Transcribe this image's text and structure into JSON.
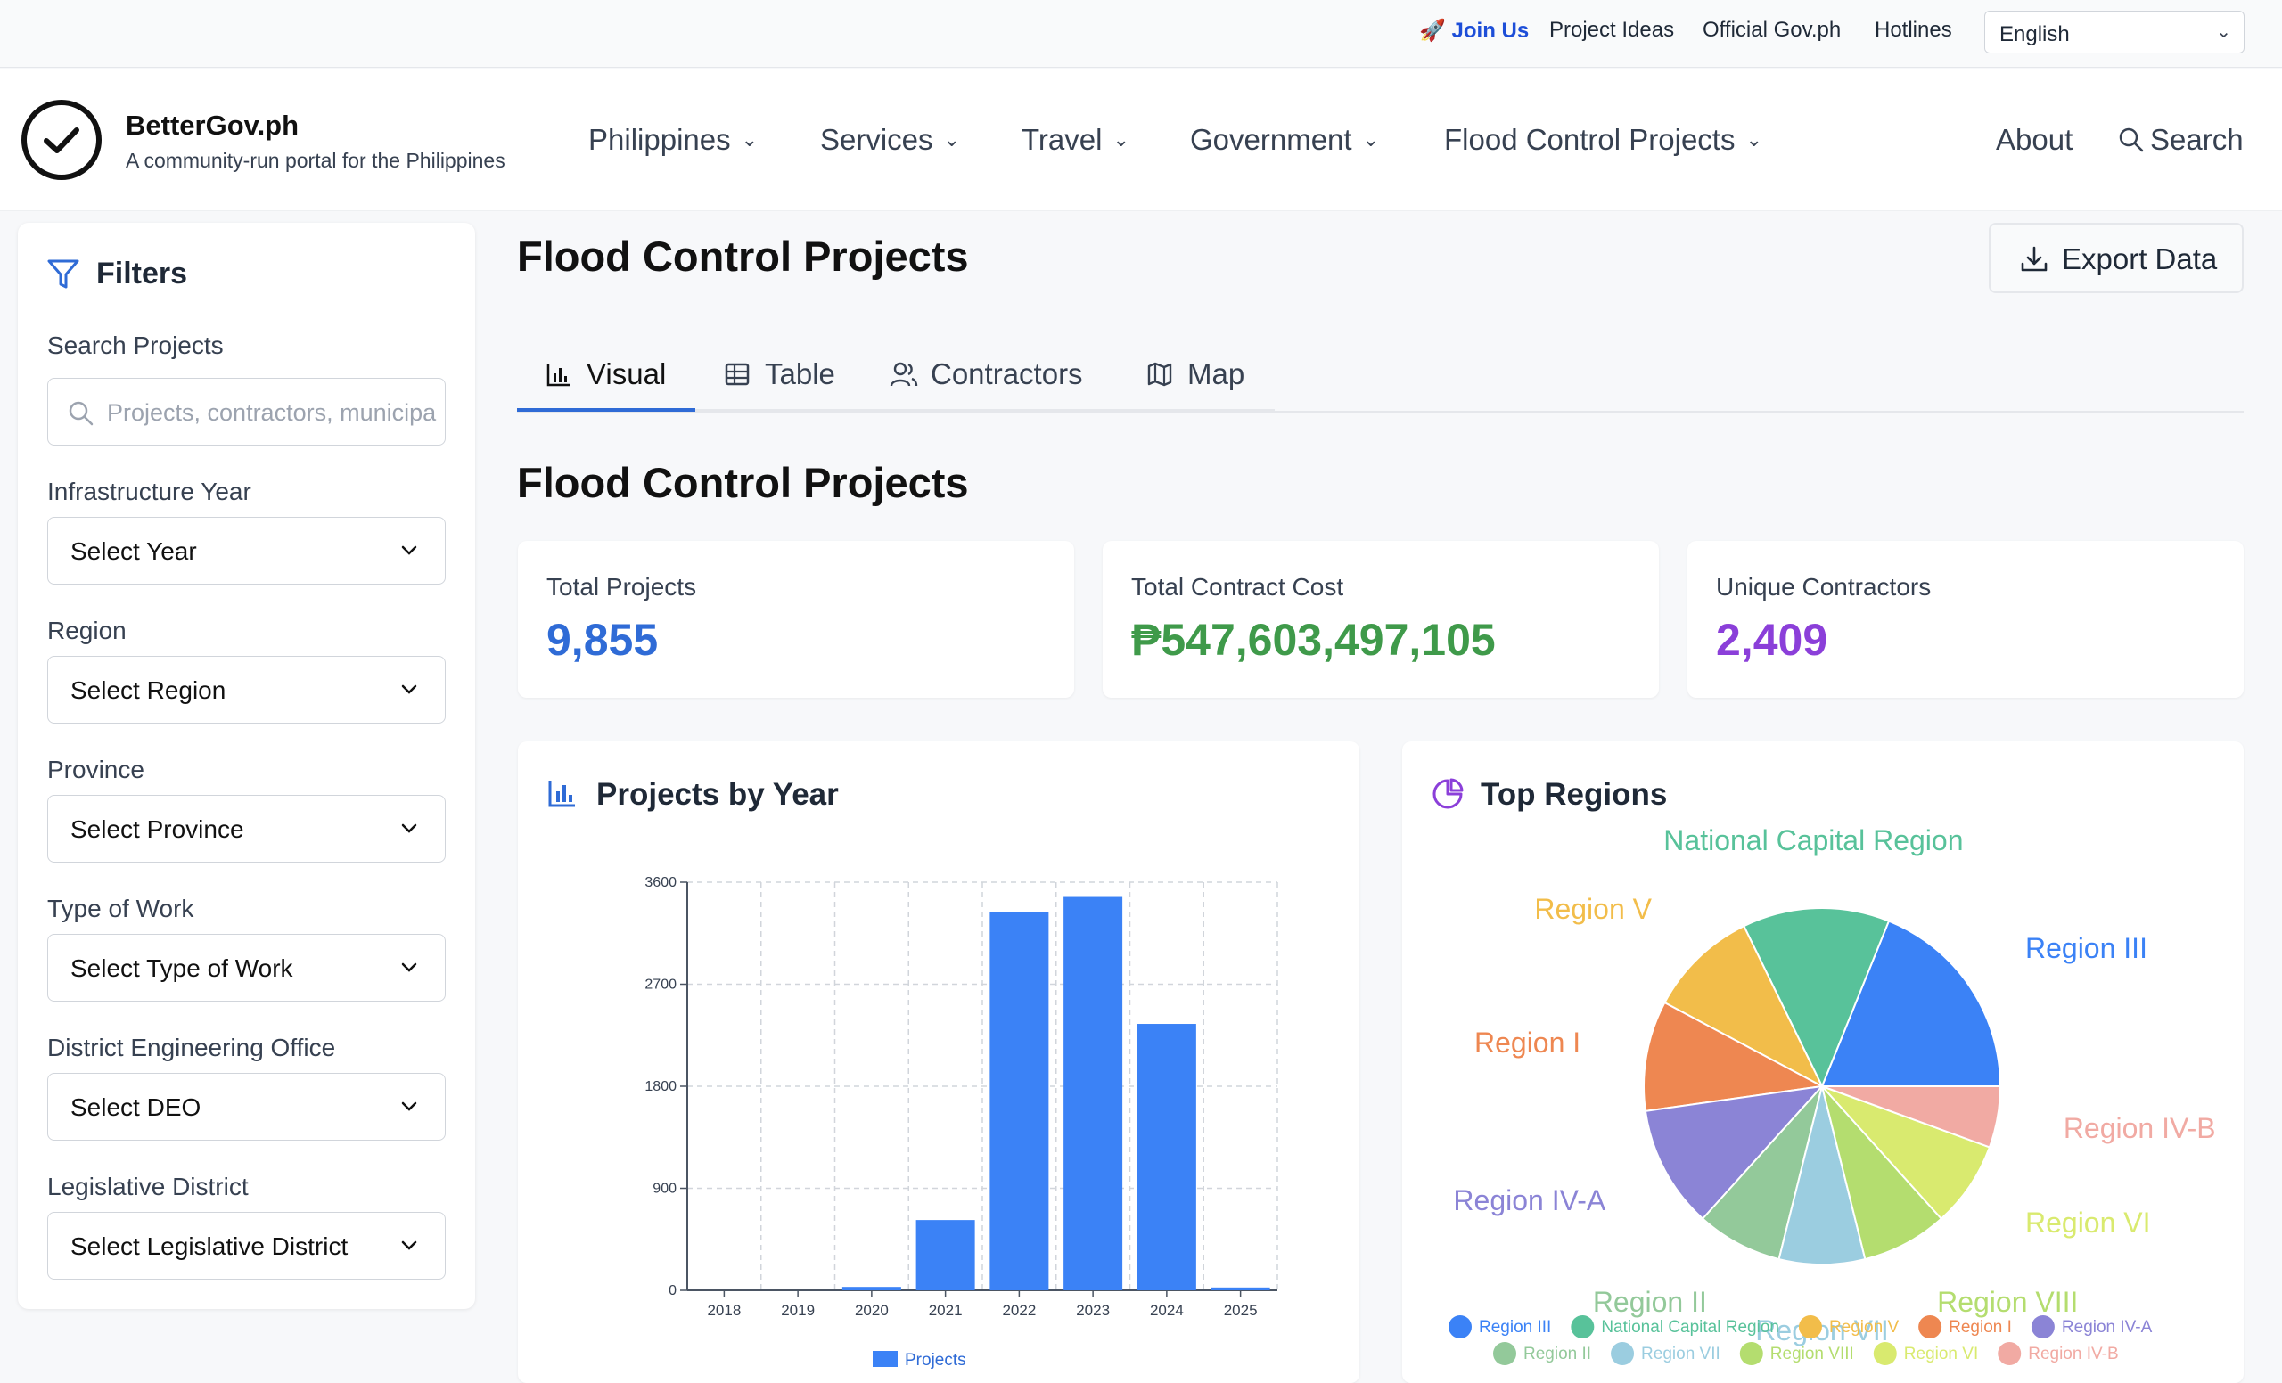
{
  "topbar": {
    "join_us": "🚀 Join Us",
    "links": [
      "Project Ideas",
      "Official Gov.ph",
      "Hotlines"
    ],
    "language": "English"
  },
  "brand": {
    "name": "BetterGov.ph",
    "tagline": "A community-run portal for the Philippines"
  },
  "nav": {
    "items": [
      "Philippines",
      "Services",
      "Travel",
      "Government",
      "Flood Control Projects"
    ],
    "about": "About",
    "search": "Search"
  },
  "filters": {
    "title": "Filters",
    "search_label": "Search Projects",
    "search_placeholder": "Projects, contractors, municipalities",
    "year_label": "Infrastructure Year",
    "year_value": "Select Year",
    "region_label": "Region",
    "region_value": "Select Region",
    "province_label": "Province",
    "province_value": "Select Province",
    "work_label": "Type of Work",
    "work_value": "Select Type of Work",
    "deo_label": "District Engineering Office",
    "deo_value": "Select DEO",
    "district_label": "Legislative District",
    "district_value": "Select Legislative District"
  },
  "page": {
    "title": "Flood Control Projects",
    "export": "Export Data",
    "tabs": [
      "Visual",
      "Table",
      "Contractors",
      "Map"
    ],
    "section_title": "Flood Control Projects"
  },
  "stats": {
    "total_projects_label": "Total Projects",
    "total_projects": "9,855",
    "total_cost_label": "Total Contract Cost",
    "total_cost": "₱547,603,497,105",
    "unique_contractors_label": "Unique Contractors",
    "unique_contractors": "2,409",
    "colors": {
      "projects": "#2f6bd6",
      "cost": "#3f9a4a",
      "contractors": "#8b3fd9"
    }
  },
  "charts": {
    "year_title": "Projects by Year",
    "regions_title": "Top Regions"
  },
  "chart_data": [
    {
      "type": "bar",
      "categories": [
        "2018",
        "2019",
        "2020",
        "2021",
        "2022",
        "2023",
        "2024",
        "2025"
      ],
      "series": [
        {
          "name": "Projects",
          "values": [
            0,
            0,
            30,
            620,
            3340,
            3470,
            2350,
            25
          ]
        }
      ],
      "y_ticks": [
        "3600",
        "2700",
        "1800",
        "900",
        "0"
      ],
      "ylim": [
        0,
        3600
      ],
      "grid": true,
      "legend": "bottom",
      "color": "#3b82f6"
    },
    {
      "type": "pie",
      "labels": [
        "Region III",
        "National Capital Region",
        "Region V",
        "Region I",
        "Region IV-A",
        "Region II",
        "Region VII",
        "Region VIII",
        "Region VI",
        "Region IV-B"
      ],
      "values": [
        17,
        12,
        9,
        9,
        10,
        7,
        7,
        7,
        7,
        5
      ],
      "colors": [
        "#3b82f6",
        "#58c29a",
        "#f2bd4a",
        "#ee8751",
        "#8b84d6",
        "#93c99a",
        "#9bcde0",
        "#b4dd6f",
        "#d9ea6f",
        "#f1aaa3"
      ],
      "legend": "bottom"
    }
  ]
}
